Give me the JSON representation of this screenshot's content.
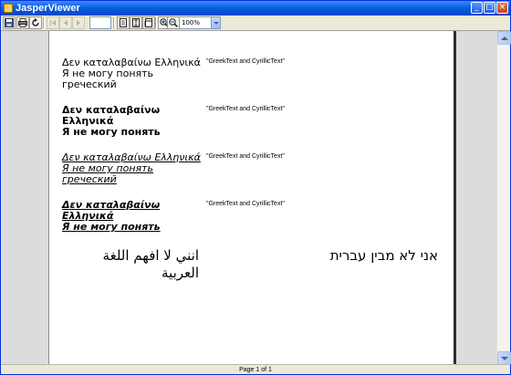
{
  "window": {
    "title": "JasperViewer",
    "minimize_glyph": "_",
    "maximize_glyph": "□",
    "close_glyph": "×"
  },
  "toolbar": {
    "buttons": [
      "save-icon",
      "print-icon",
      "reload-icon",
      "first-page-icon",
      "previous-page-icon",
      "next-page-icon",
      "last-page-icon",
      "actual-size-icon",
      "fit-page-icon",
      "fit-width-icon",
      "zoom-in-icon",
      "zoom-out-icon"
    ],
    "page_input_value": "",
    "zoom_value": "100%"
  },
  "report": {
    "rows": [
      {
        "style": "plain",
        "line1": "Δεν καταλαβαίνω Ελληνικά",
        "line2": "Я не могу понять",
        "line3": "греческий",
        "field": "\"GreekText and CyrillicText\""
      },
      {
        "style": "bold",
        "line1": "Δεν καταλαβαίνω",
        "line2": "Ελληνικά",
        "line3": "Я не могу понять",
        "field": "\"GreekText and CyrillicText\""
      },
      {
        "style": "italic-underline",
        "line1": "Δεν καταλαβαίνω Ελληνικά",
        "line2": "Я не могу понять",
        "line3": "греческий",
        "field": "\"GreekText and CyrillicText\""
      },
      {
        "style": "bold-italic-underline",
        "line1": "Δεν καταλαβαίνω",
        "line2": "Ελληνικά",
        "line3": "Я не могу понять",
        "field": "\"GreekText and CyrillicText\""
      }
    ],
    "arabic_line1": "انني لا افهم اللغة",
    "arabic_line2": "العربية",
    "hebrew": "אני לא מבין עברית"
  },
  "status": {
    "page_text": "Page 1 of 1"
  },
  "colors": {
    "titlebar": "#0a5fe0",
    "chrome": "#ece9d8",
    "viewer_bg": "#dcdcdc",
    "page_bg": "#ffffff"
  }
}
